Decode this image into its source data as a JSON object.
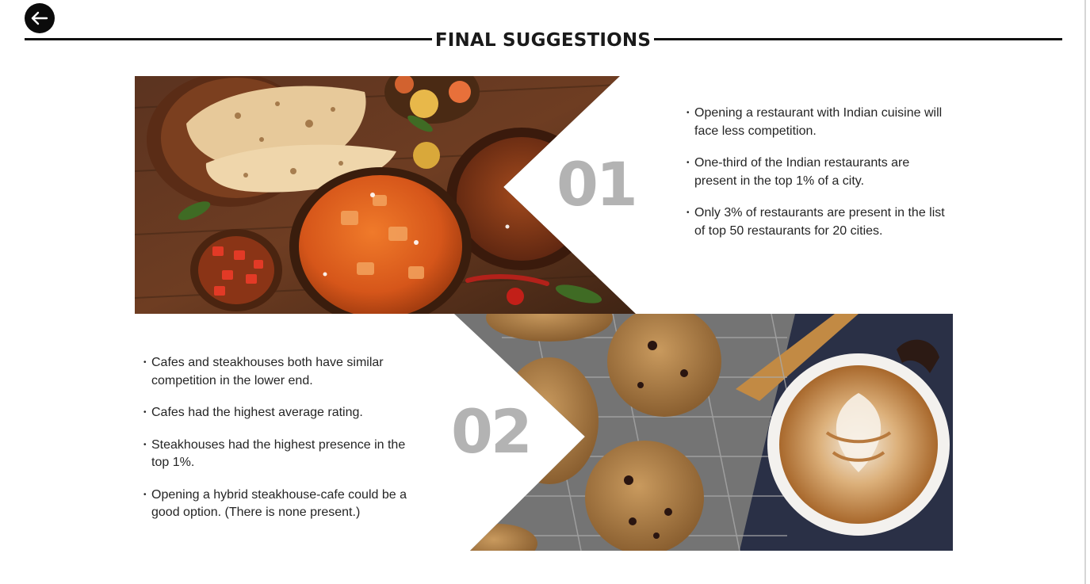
{
  "page": {
    "title": "FINAL SUGGESTIONS"
  },
  "nav": {
    "back_icon": "arrow-left-icon"
  },
  "section1": {
    "number": "01",
    "image": "indian-cuisine-photo",
    "bullets": [
      "Opening a restaurant with Indian cuisine will face less competition.",
      "One-third of the Indian restaurants are present in the top 1% of a city.",
      "Only 3% of restaurants are present in the list of top 50 restaurants for 20 cities."
    ]
  },
  "section2": {
    "number": "02",
    "image": "cookies-and-coffee-photo",
    "bullets": [
      "Cafes and steakhouses both have similar competition in the lower end.",
      "Cafes had the highest average rating.",
      "Steakhouses had the highest presence in the top 1%.",
      "Opening a hybrid steakhouse-cafe could be a good option. (There is none present.)"
    ]
  },
  "colors": {
    "number": "#b3b3b3",
    "rule": "#111111",
    "text": "#252525"
  }
}
